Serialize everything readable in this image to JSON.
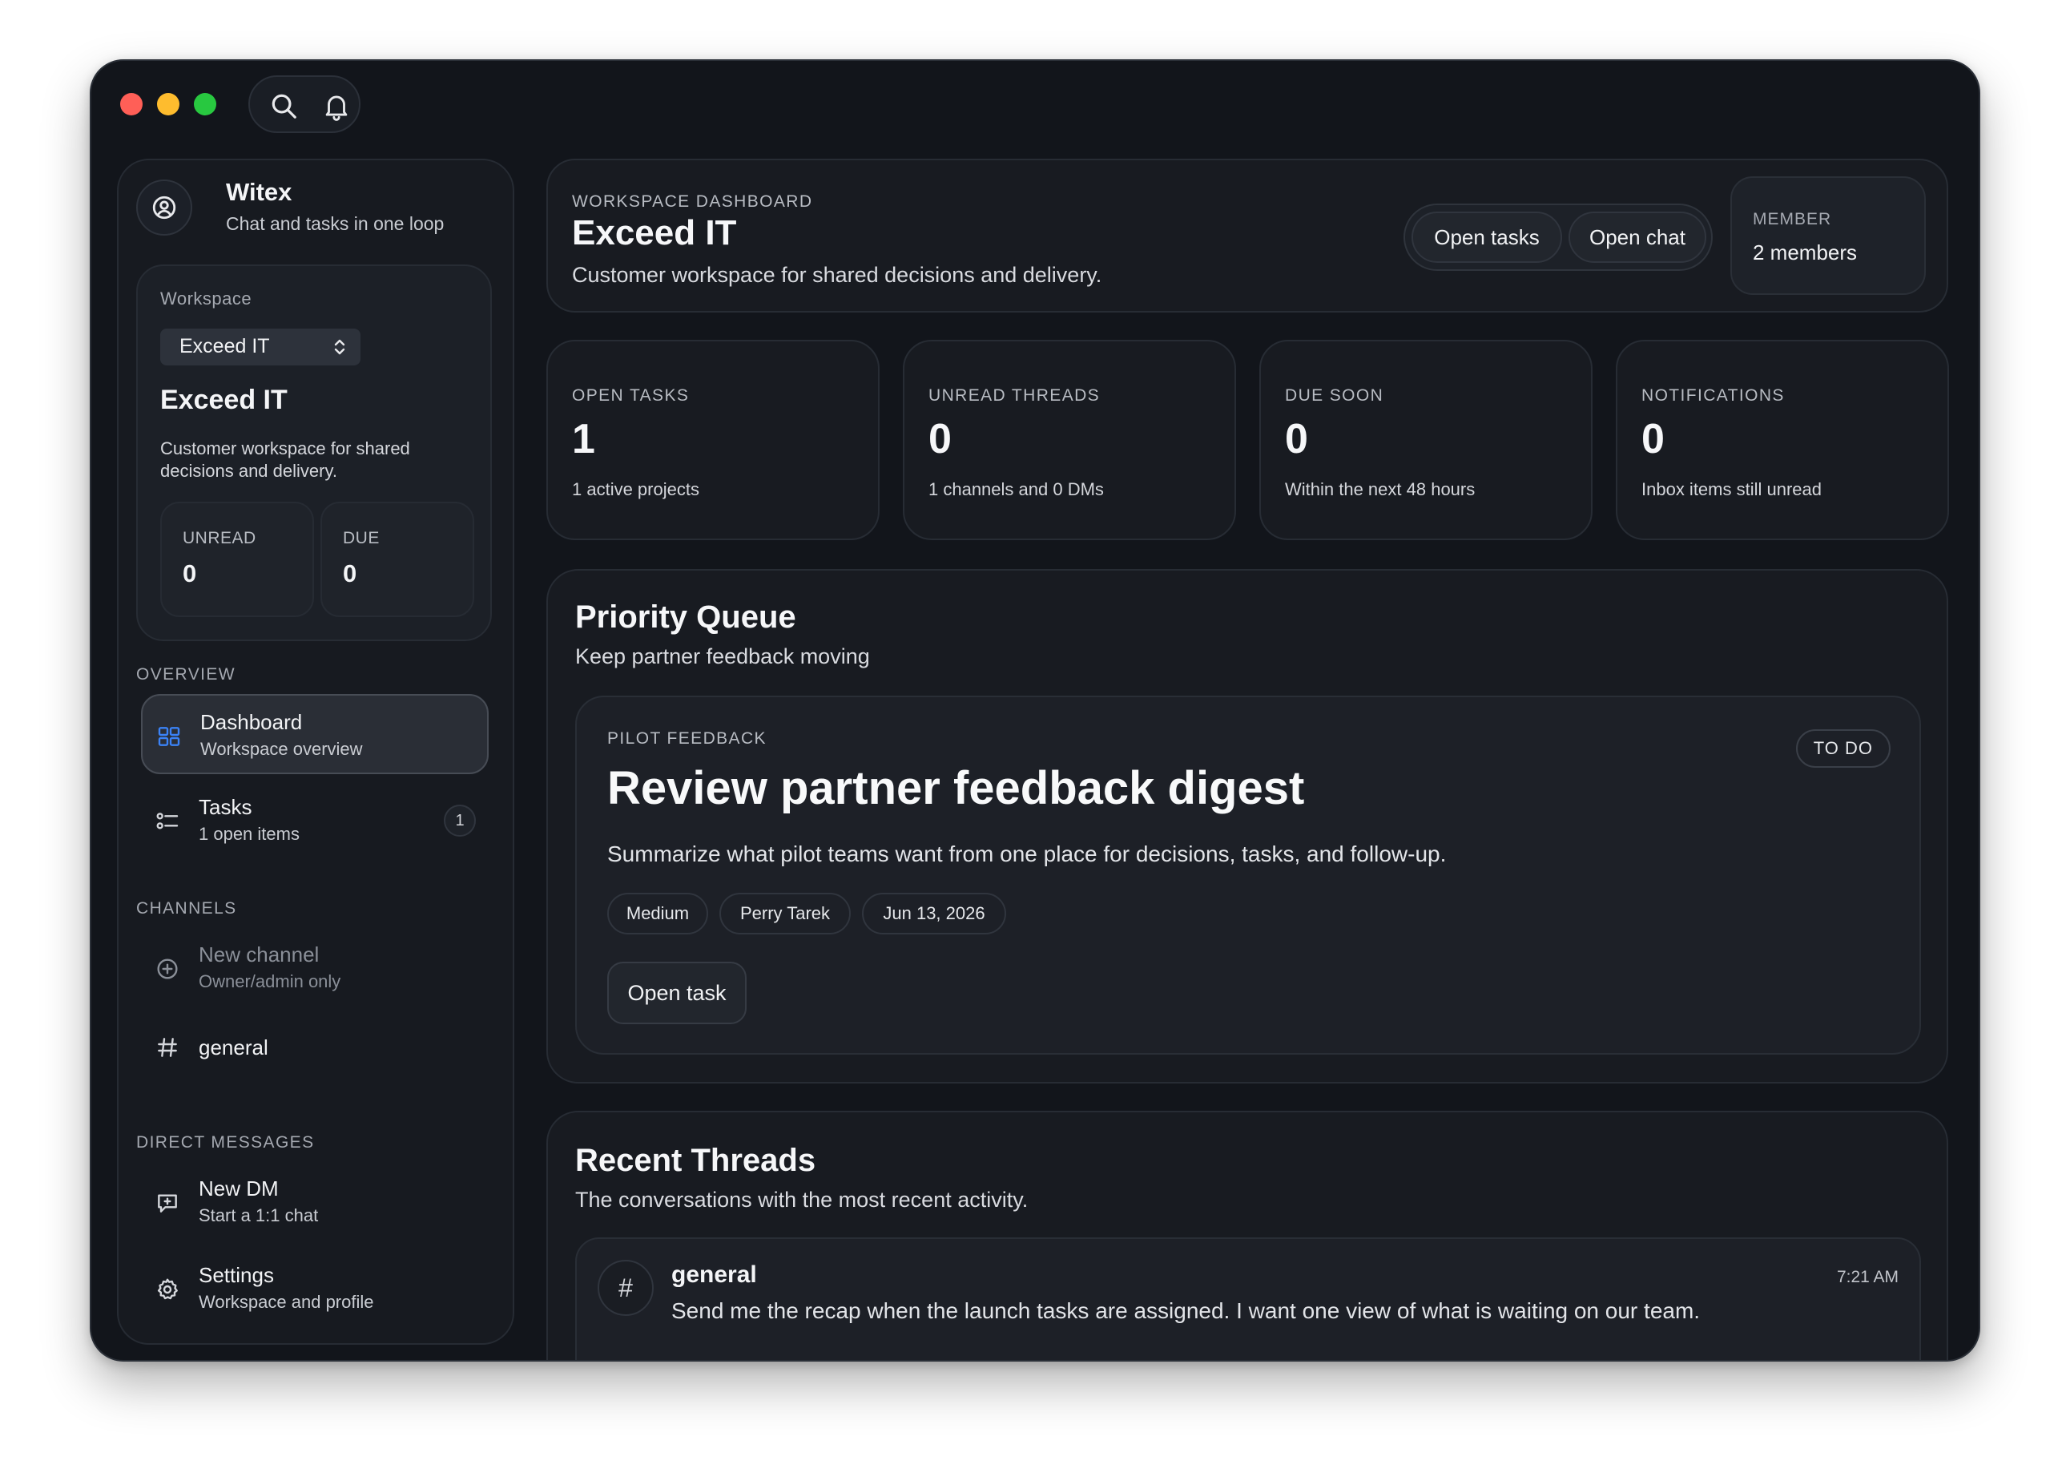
{
  "titlebar": {
    "search_icon": "search-icon",
    "bell_icon": "bell-icon"
  },
  "brand": {
    "name": "Witex",
    "tagline": "Chat and tasks in one loop"
  },
  "workspace": {
    "label": "Workspace",
    "selected": "Exceed IT",
    "title": "Exceed IT",
    "description": "Customer workspace for shared decisions and delivery.",
    "unread_label": "UNREAD",
    "unread_value": "0",
    "due_label": "DUE",
    "due_value": "0"
  },
  "sidebar": {
    "overview_heading": "OVERVIEW",
    "overview_items": [
      {
        "title": "Dashboard",
        "subtitle": "Workspace overview",
        "icon": "grid-icon",
        "active": true
      },
      {
        "title": "Tasks",
        "subtitle": "1 open items",
        "icon": "task-list-icon",
        "badge": "1"
      }
    ],
    "channels_heading": "CHANNELS",
    "new_channel": {
      "title": "New channel",
      "subtitle": "Owner/admin only",
      "icon": "plus-circle-icon"
    },
    "channels": [
      {
        "name": "general",
        "icon": "hash-icon"
      }
    ],
    "dm_heading": "DIRECT MESSAGES",
    "new_dm": {
      "title": "New DM",
      "subtitle": "Start a 1:1 chat",
      "icon": "message-plus-icon"
    },
    "settings": {
      "title": "Settings",
      "subtitle": "Workspace and profile",
      "icon": "gear-icon"
    }
  },
  "header": {
    "eyebrow": "WORKSPACE DASHBOARD",
    "title": "Exceed IT",
    "subtitle": "Customer workspace for shared decisions and delivery.",
    "open_tasks_label": "Open tasks",
    "open_chat_label": "Open chat",
    "member_label": "MEMBER",
    "member_value": "2 members"
  },
  "stats": [
    {
      "label": "OPEN TASKS",
      "value": "1",
      "sub": "1 active projects"
    },
    {
      "label": "UNREAD THREADS",
      "value": "0",
      "sub": "1 channels and 0 DMs"
    },
    {
      "label": "DUE SOON",
      "value": "0",
      "sub": "Within the next 48 hours"
    },
    {
      "label": "NOTIFICATIONS",
      "value": "0",
      "sub": "Inbox items still unread"
    }
  ],
  "priority_queue": {
    "title": "Priority Queue",
    "subtitle": "Keep partner feedback moving",
    "task": {
      "eyebrow": "PILOT FEEDBACK",
      "status": "TO DO",
      "title": "Review partner feedback digest",
      "description": "Summarize what pilot teams want from one place for decisions, tasks, and follow-up.",
      "priority": "Medium",
      "assignee": "Perry Tarek",
      "due_date": "Jun 13, 2026",
      "open_label": "Open task"
    }
  },
  "recent_threads": {
    "title": "Recent Threads",
    "subtitle": "The conversations with the most recent activity.",
    "items": [
      {
        "icon": "#",
        "name": "general",
        "message": "Send me the recap when the launch tasks are assigned. I want one view of what is waiting on our team.",
        "time": "7:21 AM"
      }
    ]
  },
  "colors": {
    "window_bg": "#12151b",
    "panel_bg": "#181b21",
    "accent_blue": "#3b82f6",
    "traffic_red": "#ff5f57",
    "traffic_yellow": "#febc2e",
    "traffic_green": "#28c840"
  }
}
